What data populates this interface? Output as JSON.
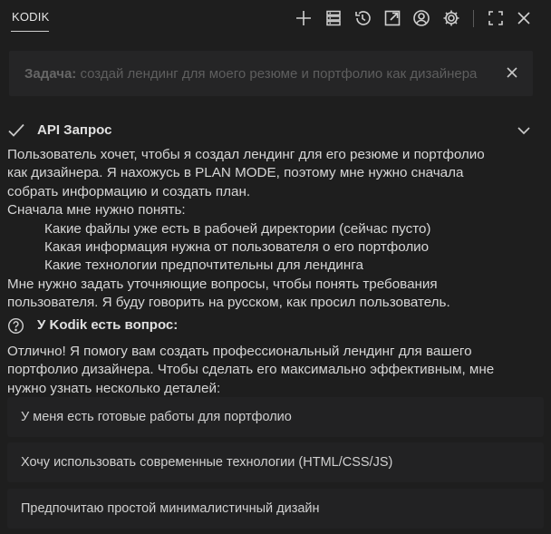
{
  "header": {
    "tab_label": "KODIK",
    "icons": [
      "plus-icon",
      "database-icon",
      "history-icon",
      "external-link-icon",
      "account-icon",
      "gear-icon",
      "fullscreen-icon",
      "close-icon"
    ]
  },
  "task": {
    "label": "Задача:",
    "text": "создай лендинг для моего резюме и портфолио как дизайнера"
  },
  "api_request": {
    "title": "API Запрос",
    "lines": [
      "Пользователь хочет, чтобы я создал лендинг для его резюме и портфолио",
      "как дизайнера. Я нахожусь в PLAN MODE, поэтому мне нужно сначала",
      "собрать информацию и создать план.",
      "Сначала мне нужно понять:"
    ],
    "list": [
      "Какие файлы уже есть в рабочей директории (сейчас пусто)",
      "Какая информация нужна от пользователя о его портфолио",
      "Какие технологии предпочтительны для лендинга"
    ],
    "after_lines": [
      "Мне нужно задать уточняющие вопросы, чтобы понять требования",
      "пользователя. Я буду говорить на русском, как просил пользователь."
    ]
  },
  "question": {
    "title": "У Kodik есть вопрос:",
    "lines": [
      "Отлично! Я помогу вам создать профессиональный лендинг для вашего",
      "портфолио дизайнера. Чтобы сделать его максимально эффективным, мне",
      "нужно узнать несколько деталей:"
    ],
    "options": [
      "У меня есть готовые работы для портфолио",
      "Хочу использовать современные технологии (HTML/CSS/JS)",
      "Предпочитаю простой минималистичный дизайн"
    ]
  }
}
